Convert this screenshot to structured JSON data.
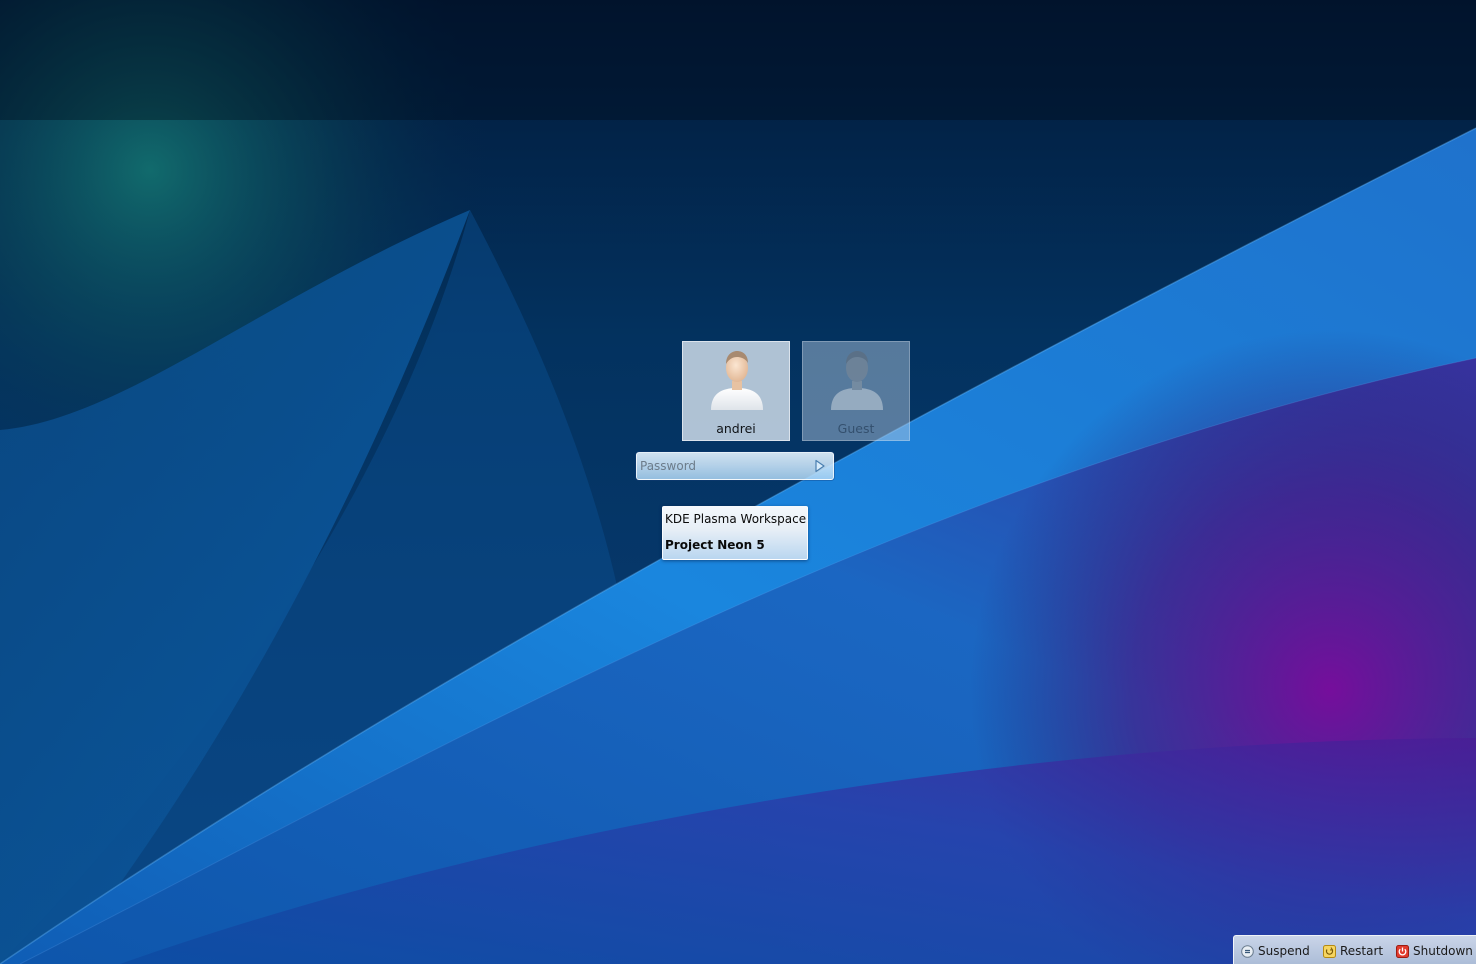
{
  "users": [
    {
      "name": "andrei",
      "selected": true,
      "avatar_icon": "user-avatar-icon"
    },
    {
      "name": "Guest",
      "selected": false,
      "avatar_icon": "guest-avatar-icon"
    }
  ],
  "password": {
    "placeholder": "Password",
    "value": "",
    "submit_icon": "login-arrow-icon"
  },
  "sessions": {
    "items": [
      "KDE Plasma Workspace",
      "Project Neon 5"
    ],
    "selected_index": 1
  },
  "power": {
    "suspend_label": "Suspend",
    "restart_label": "Restart",
    "shutdown_label": "Shutdown",
    "suspend_icon": "suspend-icon",
    "restart_icon": "restart-icon",
    "shutdown_icon": "shutdown-icon"
  },
  "colors": {
    "wallpaper_base": "#03224a",
    "wallpaper_blue": "#1a7fd6",
    "wallpaper_purple": "#6b1a9a",
    "wallpaper_teal": "#0f6a6a"
  }
}
